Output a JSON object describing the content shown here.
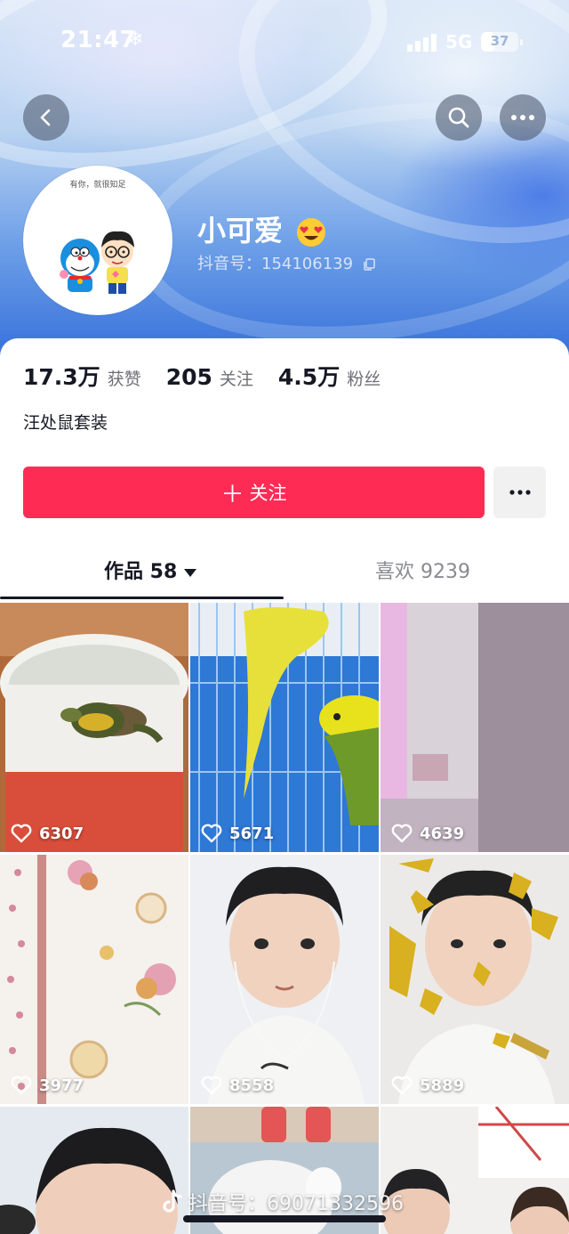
{
  "status_bar": {
    "time": "21:47",
    "network": "5G",
    "battery": "37",
    "battery_level": 0.37
  },
  "profile": {
    "nickname": "小可爱",
    "douyin_id": "抖音号：154106139",
    "avatar_caption": "有你，就很知足"
  },
  "stats": [
    {
      "value": "17.3万",
      "label": "获赞"
    },
    {
      "value": "205",
      "label": "关注"
    },
    {
      "value": "4.5万",
      "label": "粉丝"
    }
  ],
  "bio": "汪处鼠套装",
  "follow_button": {
    "label": "关注"
  },
  "tabs": [
    {
      "label": "作品 58"
    },
    {
      "label": "喜欢 9239"
    }
  ],
  "videos": [
    {
      "likes": "6307",
      "subject": "turtle in bucket"
    },
    {
      "likes": "5671",
      "subject": "budgies in cage"
    },
    {
      "likes": "4639",
      "subject": "wall corner"
    },
    {
      "likes": "3977",
      "subject": "floral fabric"
    },
    {
      "likes": "8558",
      "subject": "boy with earphones"
    },
    {
      "likes": "5889",
      "subject": "boy with leaf effect"
    },
    {
      "likes": "",
      "subject": "boy close-up"
    },
    {
      "likes": "",
      "subject": "fluffy pet"
    },
    {
      "likes": "",
      "subject": "two kids"
    }
  ],
  "watermark": "抖音号：69071332596",
  "colors": {
    "accent": "#fe2c55",
    "text": "#161823",
    "secondary": "#6e6f76"
  }
}
